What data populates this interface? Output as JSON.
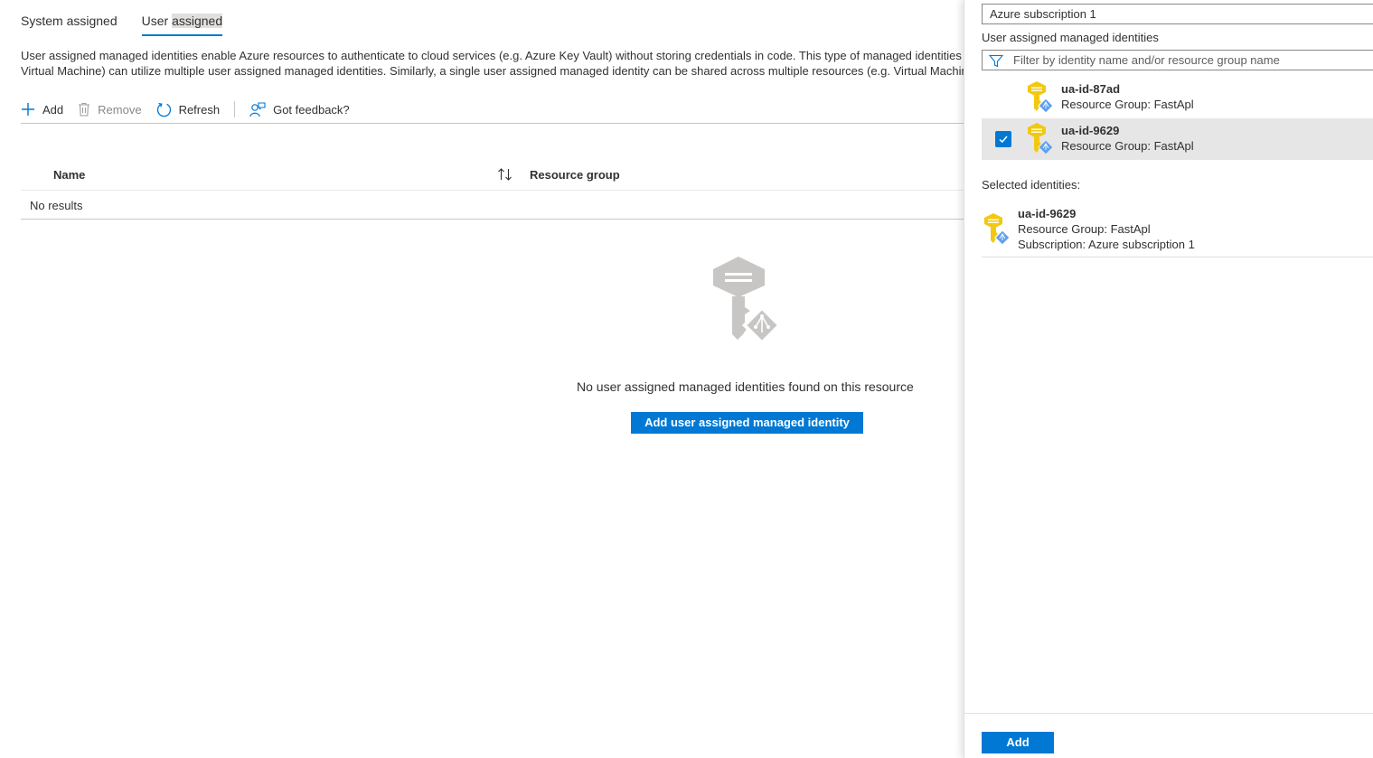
{
  "tabs": [
    {
      "label_a": "System assigned",
      "label_b": ""
    },
    {
      "label_a": "User ",
      "label_b": "assigned"
    }
  ],
  "description": {
    "line1": "User assigned managed identities enable Azure resources to authenticate to cloud services (e.g. Azure Key Vault) without storing credentials in code. This type of managed identities a",
    "line2": "Virtual Machine) can utilize multiple user assigned managed identities. Similarly, a single user assigned managed identity can be shared across multiple resources (e.g. Virtual Machine"
  },
  "toolbar": {
    "add_label": "Add",
    "remove_label": "Remove",
    "refresh_label": "Refresh",
    "feedback_label": "Got feedback?"
  },
  "grid": {
    "columns": {
      "name": "Name",
      "resource_group": "Resource group"
    },
    "no_results": "No results"
  },
  "empty_state": {
    "message": "No user assigned managed identities found on this resource",
    "button_label": "Add user assigned managed identity"
  },
  "panel": {
    "subscription_value": "Azure subscription 1",
    "identities_label": "User assigned managed identities",
    "filter_placeholder": "Filter by identity name and/or resource group name",
    "identities": [
      {
        "name": "ua-id-87ad",
        "resource_group": "Resource Group: FastApl",
        "checked": false
      },
      {
        "name": "ua-id-9629",
        "resource_group": "Resource Group: FastApl",
        "checked": true
      }
    ],
    "selected_label": "Selected identities:",
    "selected": [
      {
        "name": "ua-id-9629",
        "resource_group": "Resource Group: FastApl",
        "subscription": "Subscription: Azure subscription 1"
      }
    ],
    "add_button_label": "Add"
  },
  "colors": {
    "accent": "#0078d4",
    "key_gold": "#f2c811",
    "key_badge": "#5ea0ef",
    "empty_icon_gray": "#c8c6c4"
  },
  "icons": {
    "add": "plus-icon",
    "remove": "trash-icon",
    "refresh": "refresh-icon",
    "feedback": "feedback-person-icon",
    "sort": "sort-arrows-icon",
    "filter": "filter-funnel-icon",
    "identity": "managed-identity-key-icon",
    "checkbox": "checkmark-icon"
  }
}
